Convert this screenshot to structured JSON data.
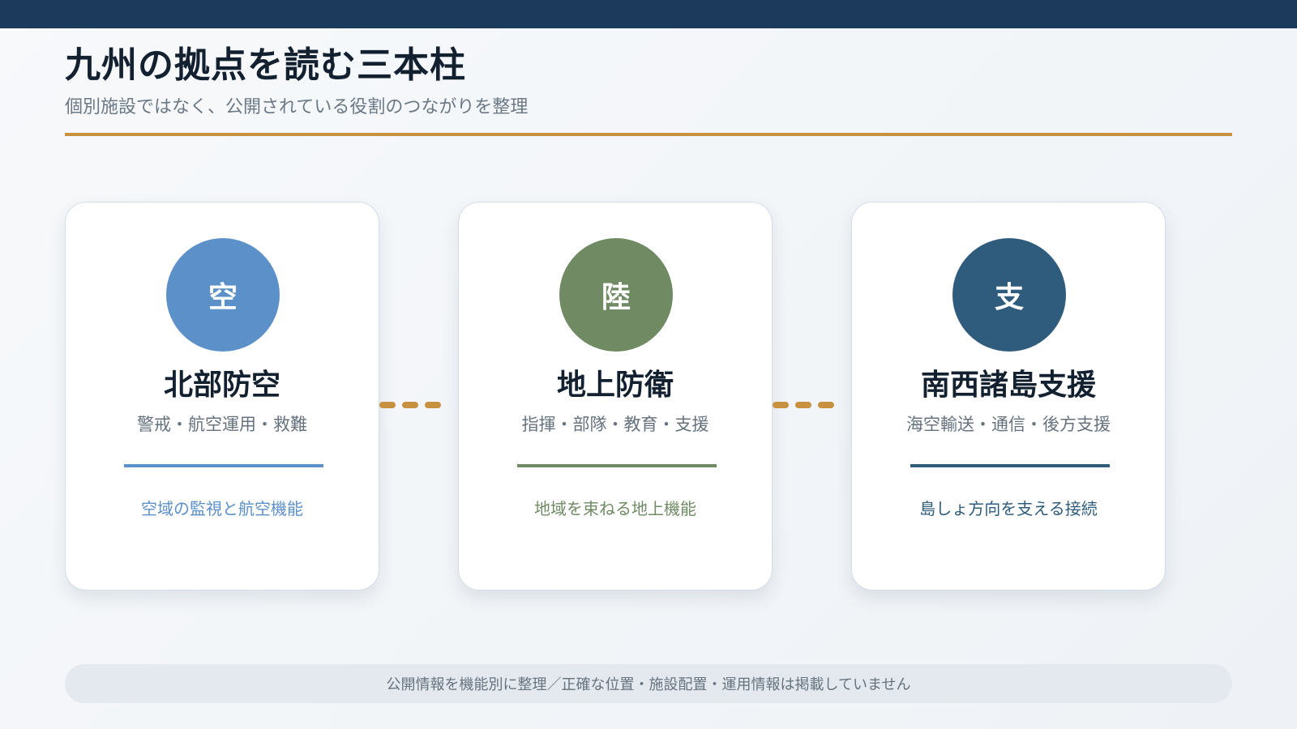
{
  "header": {
    "title": "九州の拠点を読む三本柱",
    "subtitle": "個別施設ではなく、公開されている役割のつながりを整理"
  },
  "accent_color": "#c8913f",
  "cards": [
    {
      "badge": "空",
      "title": "北部防空",
      "subtitle": "警戒・航空運用・救難",
      "caption": "空域の監視と航空機能",
      "color": "#5b90c8"
    },
    {
      "badge": "陸",
      "title": "地上防衛",
      "subtitle": "指揮・部隊・教育・支援",
      "caption": "地域を束ねる地上機能",
      "color": "#708a64"
    },
    {
      "badge": "支",
      "title": "南西諸島支援",
      "subtitle": "海空輸送・通信・後方支援",
      "caption": "島しょ方向を支える接続",
      "color": "#2f5b7c"
    }
  ],
  "footer": {
    "note": "公開情報を機能別に整理／正確な位置・施設配置・運用情報は掲載していません"
  }
}
